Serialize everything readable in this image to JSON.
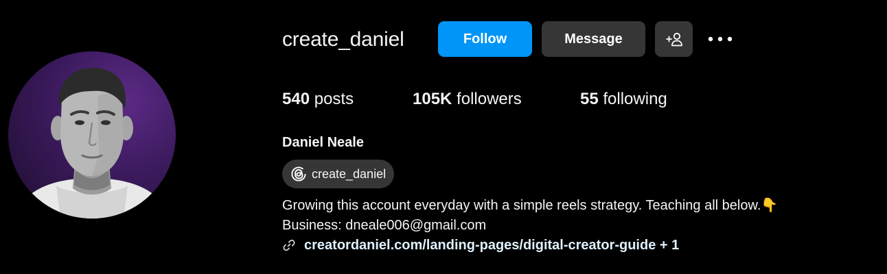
{
  "profile": {
    "username": "create_daniel",
    "full_name": "Daniel Neale",
    "avatar_icon": "profile-photo"
  },
  "actions": {
    "follow_label": "Follow",
    "message_label": "Message",
    "suggest_icon": "person-add-icon",
    "more_icon": "more-options-icon"
  },
  "stats": {
    "posts_count": "540",
    "posts_label": "posts",
    "followers_count": "105K",
    "followers_label": "followers",
    "following_count": "55",
    "following_label": "following"
  },
  "bio": {
    "threads_handle": "create_daniel",
    "threads_icon": "threads-icon",
    "line1": "Growing this account everyday with a simple reels strategy. Teaching all below.👇",
    "line2": "Business: dneale006@gmail.com",
    "link": "creatordaniel.com/landing-pages/digital-creator-guide + 1",
    "link_icon": "link-icon"
  },
  "colors": {
    "background": "#000000",
    "follow_button": "#0095f6",
    "secondary_button": "#363636",
    "link": "#e0f1ff"
  }
}
